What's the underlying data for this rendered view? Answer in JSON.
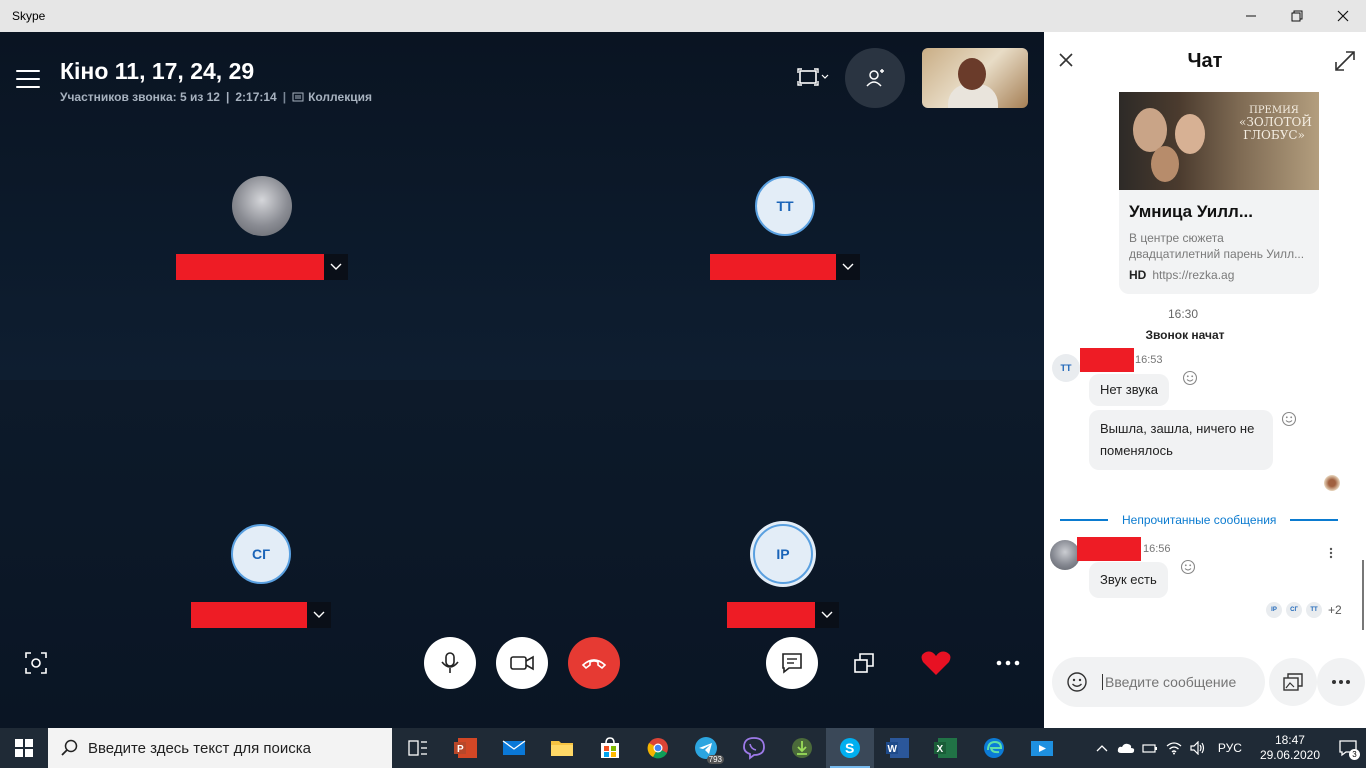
{
  "window": {
    "title": "Skype",
    "minimize": "—",
    "maximize": "❐",
    "close": "✕"
  },
  "call": {
    "title": "Кіно 11, 17, 24, 29",
    "participants": "Участников звонка: 5 из 12",
    "sep1": "|",
    "duration": "2:17:14",
    "sep2": "|",
    "collection": "Коллекция",
    "tiles": [
      {
        "initials": "",
        "avatar": "photo"
      },
      {
        "initials": "ТТ",
        "avatar": "initials"
      },
      {
        "initials": "СГ",
        "avatar": "initials"
      },
      {
        "initials": "IP",
        "avatar": "initials"
      }
    ]
  },
  "chat": {
    "title": "Чат",
    "link_card": {
      "title": "Умница Уилл...",
      "description": "В центре сюжета двадцатилетний парень Уилл...",
      "badge": "HD",
      "url": "https://rezka.ag",
      "poster_text_1": "ПРЕМИЯ",
      "poster_text_2": "«ЗОЛОТОЙ",
      "poster_text_3": "ГЛОБУС»"
    },
    "time_1": "16:30",
    "call_started": "Звонок начат",
    "msg_group_1": {
      "avatar": "ТТ",
      "time": "16:53",
      "messages": [
        "Нет звука",
        "Вышла, зашла, ничего не поменялось"
      ]
    },
    "unread_label": "Непрочитанные сообщения",
    "msg_group_2": {
      "time": "16:56",
      "messages": [
        "Звук есть"
      ]
    },
    "seen_by": [
      "IP",
      "СГ",
      "ТТ"
    ],
    "seen_more": "+2",
    "composer_placeholder": "Введите сообщение"
  },
  "taskbar": {
    "search_placeholder": "Введите здесь текст для поиска",
    "telegram_badge": "793",
    "lang": "РУС",
    "time": "18:47",
    "date": "29.06.2020",
    "notifications": "3"
  },
  "colors": {
    "accent": "#0b7bd0",
    "end_call": "#e63a33",
    "redaction": "#ee1c25",
    "heart": "#e81123"
  }
}
